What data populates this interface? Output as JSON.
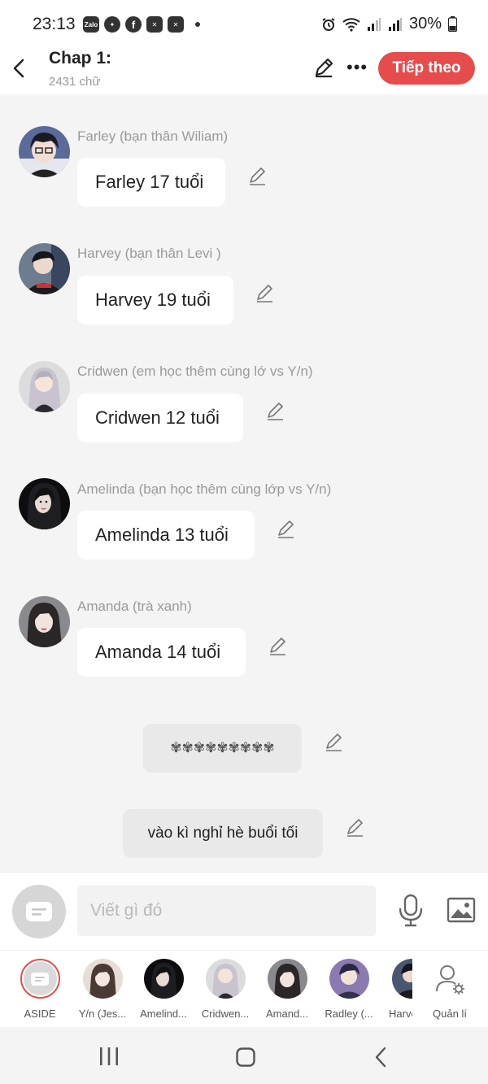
{
  "status_bar": {
    "time": "23:13",
    "apps": [
      "Zalo",
      "messenger-icon",
      "facebook-icon",
      "capcut-icon",
      "capcut-icon"
    ],
    "battery": "30%"
  },
  "header": {
    "title": "Chap 1:",
    "word_count": "2431 chữ",
    "next_label": "Tiếp theo",
    "accent": "#e74c4c"
  },
  "messages": [
    {
      "sender": "Farley (bạn thân Wiliam)",
      "text": "Farley 17 tuổi"
    },
    {
      "sender": "Harvey (bạn thân Levi )",
      "text": "Harvey 19 tuổi"
    },
    {
      "sender": "Cridwen (em học thêm cùng lớ vs Y/n)",
      "text": "Cridwen 12 tuổi"
    },
    {
      "sender": "Amelinda (bạn học thêm cùng lớp vs Y/n)",
      "text": "Amelinda 13 tuổi"
    },
    {
      "sender": "Amanda (trà xanh)",
      "text": "Amanda 14 tuổi"
    }
  ],
  "narration": [
    {
      "text": "✾✾✾✾✾✾✾✾✾"
    },
    {
      "text": "vào kì nghỉ hè buổi tối"
    }
  ],
  "composer": {
    "placeholder": "Viết gì đó"
  },
  "characters": [
    {
      "label": "ASIDE"
    },
    {
      "label": "Y/n (Jes..."
    },
    {
      "label": "Amelind..."
    },
    {
      "label": "Cridwen..."
    },
    {
      "label": "Amand..."
    },
    {
      "label": "Radley (..."
    },
    {
      "label": "Harve"
    },
    {
      "label": "Quản lí"
    }
  ]
}
